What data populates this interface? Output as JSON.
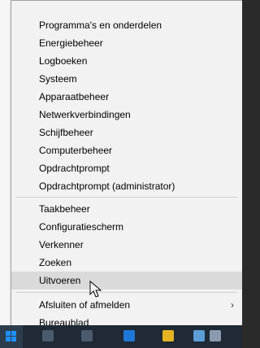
{
  "menu": {
    "group1": [
      {
        "label": "Programma's en onderdelen"
      },
      {
        "label": "Energiebeheer"
      },
      {
        "label": "Logboeken"
      },
      {
        "label": "Systeem"
      },
      {
        "label": "Apparaatbeheer"
      },
      {
        "label": "Netwerkverbindingen"
      },
      {
        "label": "Schijfbeheer"
      },
      {
        "label": "Computerbeheer"
      },
      {
        "label": "Opdrachtprompt"
      },
      {
        "label": "Opdrachtprompt (administrator)"
      }
    ],
    "group2": [
      {
        "label": "Taakbeheer"
      },
      {
        "label": "Configuratiescherm"
      },
      {
        "label": "Verkenner"
      },
      {
        "label": "Zoeken"
      },
      {
        "label": "Uitvoeren",
        "hovered": true
      }
    ],
    "group3": [
      {
        "label": "Afsluiten of afmelden",
        "has_submenu": true
      },
      {
        "label": "Bureaublad"
      }
    ],
    "submenu_arrow": "›"
  },
  "colors": {
    "accent": "#1e90ff",
    "taskbar": "#1f2a36",
    "menu_bg": "#f2f2f2",
    "hover_bg": "#dadada"
  },
  "icons": [
    "windows-start-icon",
    "cursor-icon"
  ]
}
